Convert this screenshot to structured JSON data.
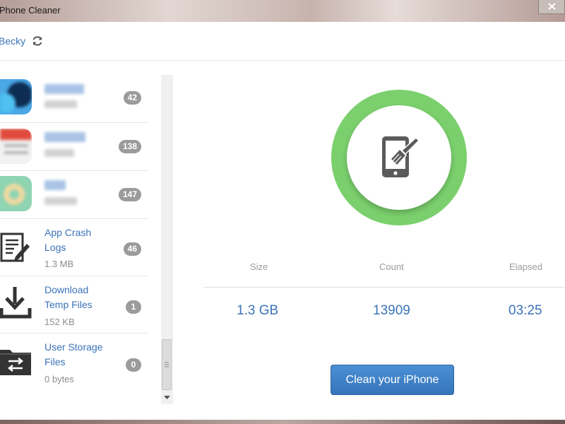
{
  "window": {
    "title": "iPhone Cleaner"
  },
  "toolbar": {
    "device_name": "Becky"
  },
  "sidebar": {
    "items": [
      {
        "name": "",
        "size": "",
        "count": "42",
        "blurred": true
      },
      {
        "name": "",
        "size": "",
        "count": "138",
        "blurred": true
      },
      {
        "name": "",
        "size": "",
        "count": "147",
        "blurred": true
      },
      {
        "name": "App Crash\nLogs",
        "size": "1.3 MB",
        "count": "46",
        "icon": "document-pen-icon"
      },
      {
        "name": "Download\nTemp Files",
        "size": "152 KB",
        "count": "1",
        "icon": "download-icon"
      },
      {
        "name": "User Storage\nFiles",
        "size": "0 bytes",
        "count": "0",
        "icon": "folder-sync-icon"
      }
    ]
  },
  "stats": {
    "size_label": "Size",
    "count_label": "Count",
    "elapsed_label": "Elapsed",
    "size_value": "1.3 GB",
    "count_value": "13909",
    "elapsed_value": "03:25"
  },
  "actions": {
    "clean_label": "Clean your iPhone"
  },
  "colors": {
    "accent": "#3b73b9",
    "ring": "#7bd06d",
    "badge": "#9b9b9b"
  }
}
